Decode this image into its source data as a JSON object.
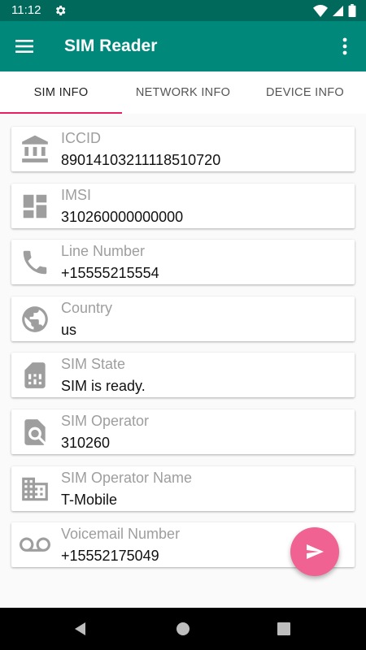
{
  "status_bar": {
    "time": "11:12"
  },
  "app_bar": {
    "title": "SIM Reader"
  },
  "tabs": [
    {
      "label": "SIM INFO",
      "active": true
    },
    {
      "label": "NETWORK INFO",
      "active": false
    },
    {
      "label": "DEVICE INFO",
      "active": false
    }
  ],
  "cards": [
    {
      "icon": "bank-icon",
      "label": "ICCID",
      "value": "89014103211118510720"
    },
    {
      "icon": "dashboard-icon",
      "label": "IMSI",
      "value": "310260000000000"
    },
    {
      "icon": "phone-icon",
      "label": "Line Number",
      "value": "+15555215554"
    },
    {
      "icon": "globe-icon",
      "label": "Country",
      "value": "us"
    },
    {
      "icon": "sim-card-icon",
      "label": "SIM State",
      "value": "SIM is ready."
    },
    {
      "icon": "find-in-page-icon",
      "label": "SIM Operator",
      "value": "310260"
    },
    {
      "icon": "business-icon",
      "label": "SIM Operator Name",
      "value": "T-Mobile"
    },
    {
      "icon": "voicemail-icon",
      "label": "Voicemail Number",
      "value": "+15552175049"
    }
  ],
  "fab": {
    "icon": "send-icon"
  },
  "colors": {
    "status_bar": "#00695c",
    "app_bar": "#00897b",
    "tab_indicator": "#e91e63",
    "fab": "#f06292",
    "icon_grey": "#9e9e9e"
  }
}
